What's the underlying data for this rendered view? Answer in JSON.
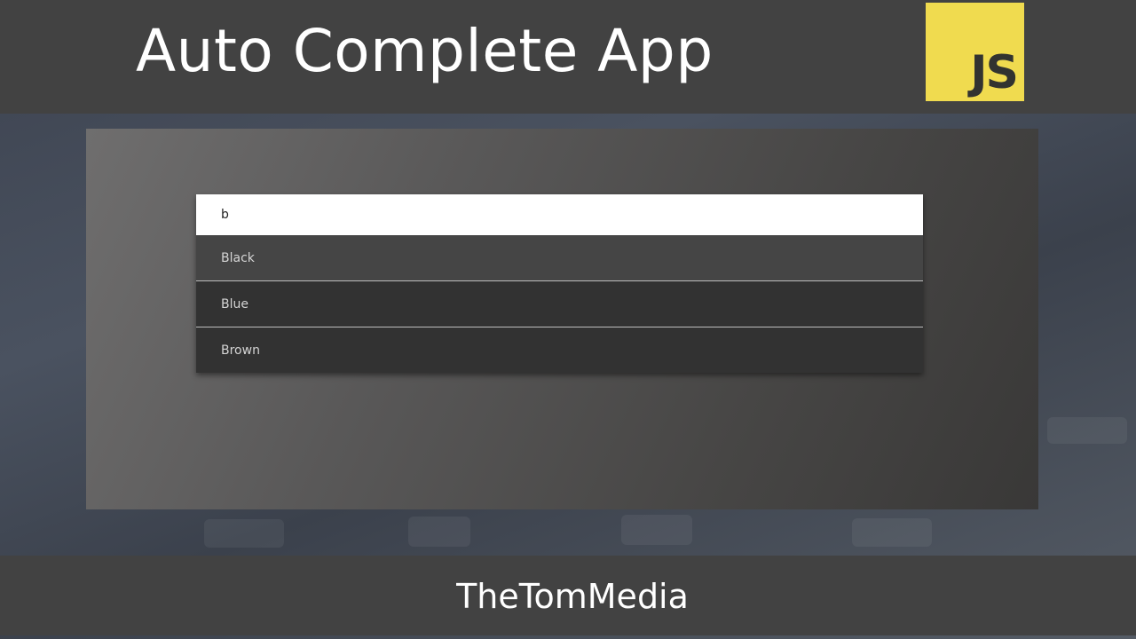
{
  "header": {
    "title": "Auto Complete App",
    "logo_text": "JS",
    "logo_color": "#f0db4f"
  },
  "search": {
    "value": "b",
    "placeholder": ""
  },
  "suggestions": [
    {
      "label": "Black"
    },
    {
      "label": "Blue"
    },
    {
      "label": "Brown"
    }
  ],
  "footer": {
    "brand": "TheTomMedia"
  },
  "colors": {
    "band": "#424242",
    "dropdown": "#323232",
    "dropdown_highlight": "#454545"
  }
}
